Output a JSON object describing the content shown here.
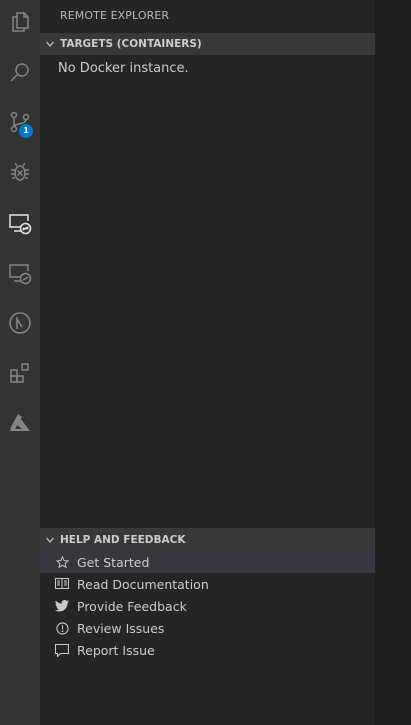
{
  "activity_bar": {
    "icons": [
      "files-icon",
      "search-icon",
      "source-control-icon",
      "debug-icon",
      "remote-explorer-icon",
      "remote-explorer-2-icon",
      "timeline-icon",
      "extensions-icon",
      "azure-icon"
    ],
    "scm_badge": "1"
  },
  "sidebar": {
    "title": "REMOTE EXPLORER",
    "targets": {
      "header": "TARGETS (CONTAINERS)",
      "message": "No Docker instance."
    },
    "help": {
      "header": "HELP AND FEEDBACK",
      "items": [
        {
          "label": "Get Started",
          "icon": "star-icon"
        },
        {
          "label": "Read Documentation",
          "icon": "book-icon"
        },
        {
          "label": "Provide Feedback",
          "icon": "twitter-icon"
        },
        {
          "label": "Review Issues",
          "icon": "issues-icon"
        },
        {
          "label": "Report Issue",
          "icon": "comment-icon"
        }
      ]
    }
  },
  "colors": {
    "accent": "#007acc",
    "activity_bar": "#333333",
    "sidebar": "#252526",
    "section_header": "#383838"
  }
}
